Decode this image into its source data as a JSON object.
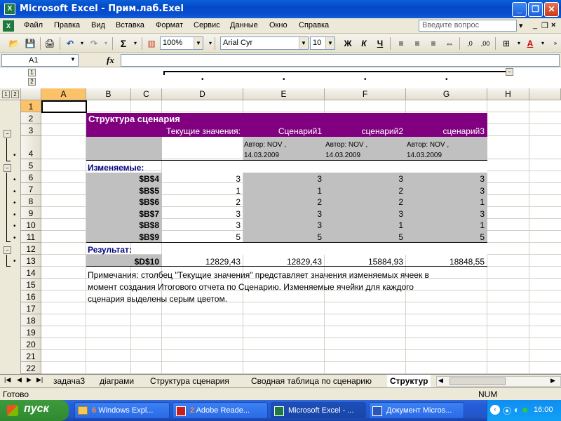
{
  "window": {
    "title": "Microsoft Excel - Прим.лаб.Exel"
  },
  "menu": {
    "items": [
      "Файл",
      "Правка",
      "Вид",
      "Вставка",
      "Формат",
      "Сервис",
      "Данные",
      "Окно",
      "Справка"
    ],
    "help_placeholder": "Введите вопрос"
  },
  "toolbar": {
    "zoom": "100%",
    "font": "Arial Cyr",
    "size": "10",
    "bold": "Ж",
    "italic": "К",
    "underline": "Ч"
  },
  "formula": {
    "cell": "A1",
    "fx": "fx",
    "value": ""
  },
  "outline": {
    "levels": [
      "1",
      "2"
    ]
  },
  "columns": [
    "A",
    "B",
    "C",
    "D",
    "E",
    "F",
    "G",
    "H"
  ],
  "rows": [
    "1",
    "2",
    "3",
    "4",
    "5",
    "6",
    "7",
    "8",
    "9",
    "10",
    "11",
    "12",
    "13",
    "14",
    "15",
    "16",
    "17",
    "18",
    "19",
    "20",
    "21",
    "22"
  ],
  "report": {
    "title": "Структура сценария",
    "header_current": "Текущие значения:",
    "scenarios": [
      "Сценарий1",
      "сценарий2",
      "сценарий3"
    ],
    "author_lines": [
      [
        "Автор: NOV ,",
        "14.03.2009"
      ],
      [
        "Автор: NOV ,",
        "14.03.2009"
      ],
      [
        "Автор: NOV ,",
        "14.03.2009"
      ]
    ],
    "changing_label": "Изменяемые:",
    "changing": [
      {
        "cell": "$B$4",
        "current": "3",
        "s1": "3",
        "s2": "3",
        "s3": "3"
      },
      {
        "cell": "$B$5",
        "current": "1",
        "s1": "1",
        "s2": "2",
        "s3": "3"
      },
      {
        "cell": "$B$6",
        "current": "2",
        "s1": "2",
        "s2": "2",
        "s3": "1"
      },
      {
        "cell": "$B$7",
        "current": "3",
        "s1": "3",
        "s2": "3",
        "s3": "3"
      },
      {
        "cell": "$B$8",
        "current": "3",
        "s1": "3",
        "s2": "1",
        "s3": "1"
      },
      {
        "cell": "$B$9",
        "current": "5",
        "s1": "5",
        "s2": "5",
        "s3": "5"
      }
    ],
    "result_label": "Результат:",
    "result": {
      "cell": "$D$10",
      "current": "12829,43",
      "s1": "12829,43",
      "s2": "15884,93",
      "s3": "18848,55"
    },
    "notes": [
      "Примечания: столбец \"Текущие значения\" представляет значения изменяемых ячеек в",
      "момент создания Итогового отчета по Сценарию. Изменяемые ячейки для каждого",
      "сценария выделены серым цветом."
    ]
  },
  "tabs": [
    "задача3",
    "діаграми",
    "Структура сценария",
    "Сводная таблица по сценарию",
    "Структур"
  ],
  "status": {
    "left": "Готово",
    "num": "NUM"
  },
  "taskbar": {
    "start": "пуск",
    "tasks": [
      "Windows Expl...",
      "Adobe Reade...",
      "Microsoft Excel - ...",
      "Документ Micros..."
    ],
    "task_counts": [
      "6",
      "2"
    ],
    "time": "16:00"
  },
  "colors": {
    "accent": "#800080",
    "grey": "#c0c0c0",
    "selected_header": "#fbc26a"
  }
}
